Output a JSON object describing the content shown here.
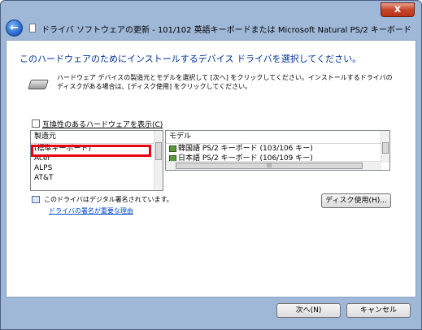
{
  "window": {
    "title": "ドライバ ソフトウェアの更新 - 101/102 英語キーボードまたは Microsoft Natural PS/2 キーボード",
    "close_glyph": "x"
  },
  "heading": "このハードウェアのためにインストールするデバイス ドライバを選択してください。",
  "description": "ハードウェア デバイスの製造元とモデルを選択して [次へ] をクリックしてください。インストールするドライバのディスクがある場合は、[ディスク使用] をクリックしてください。",
  "compatible_checkbox": {
    "label": "互換性のあるハードウェアを表示(C)",
    "checked": false
  },
  "manufacturer_list": {
    "header": "製造元",
    "items": [
      "(標準キーボード)",
      "Acer",
      "ALPS",
      "AT&T"
    ],
    "selected": "(標準キーボード)"
  },
  "model_list": {
    "header": "モデル",
    "items": [
      "韓国語 PS/2 キーボード (103/106 キー)",
      "日本語 PS/2 キーボード (106/109 キー)"
    ]
  },
  "signature": {
    "status": "このドライバはデジタル署名されています。",
    "link": "ドライバの署名が重要な理由"
  },
  "buttons": {
    "have_disk": "ディスク使用(H)...",
    "next": "次へ(N)",
    "cancel": "キャンセル"
  },
  "icons": [
    "back-arrow-icon",
    "document-icon",
    "keyboard-icon",
    "driver-icon",
    "signed-driver-icon",
    "close-icon"
  ],
  "colors": {
    "heading": "#003399",
    "link": "#0044cc",
    "highlight_box": "#e60012",
    "close_button": "#c6452a"
  }
}
